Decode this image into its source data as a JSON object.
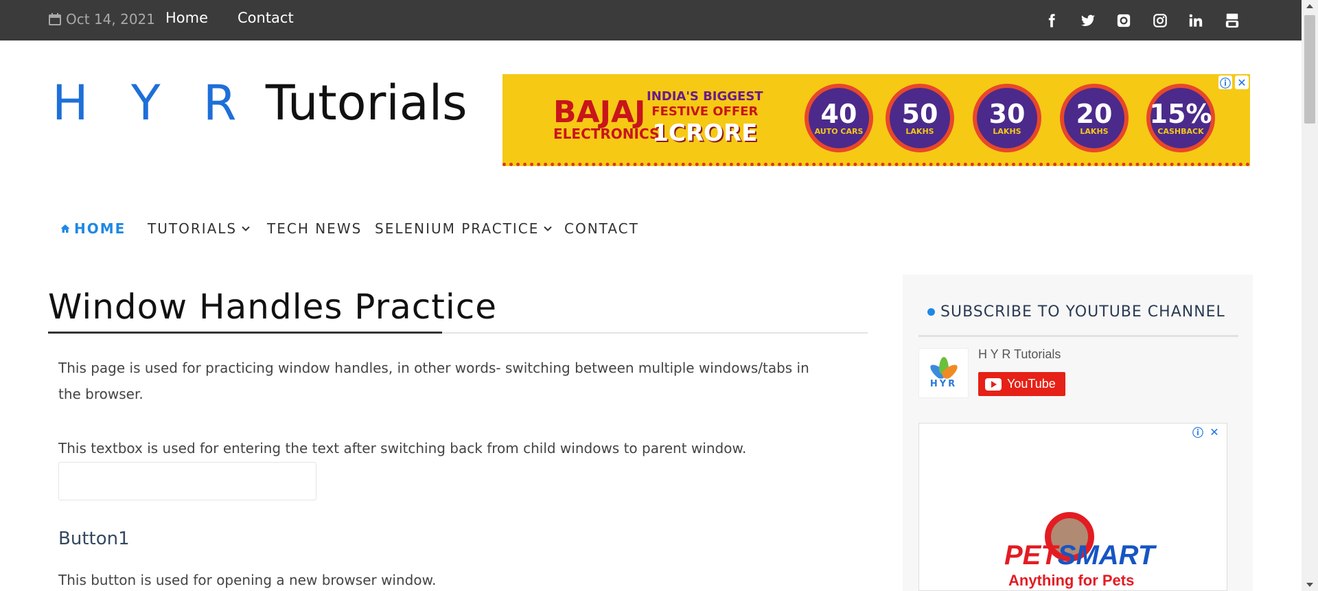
{
  "topbar": {
    "date": "Oct 14, 2021",
    "links": [
      "Home",
      "Contact"
    ],
    "social_icons": [
      "facebook-icon",
      "twitter-icon",
      "github-icon",
      "instagram-icon",
      "linkedin-icon",
      "youtube-icon"
    ]
  },
  "header": {
    "logo_hyr": "H Y R",
    "logo_tutorials": "Tutorials"
  },
  "ad_banner": {
    "brand": "BAJAJ",
    "brand_sub": "ELECTRONICS",
    "offer_line1": "INDIA'S BIGGEST",
    "offer_line2": "FESTIVE OFFER",
    "offer_amount": "1CRORE",
    "badges": [
      {
        "num": "40",
        "unit": "AUTO CARS"
      },
      {
        "num": "50",
        "unit": "LAKHS"
      },
      {
        "num": "30",
        "unit": "LAKHS"
      },
      {
        "num": "20",
        "unit": "LAKHS"
      },
      {
        "num": "15%",
        "unit": "CASHBACK"
      }
    ]
  },
  "nav": {
    "items": [
      {
        "label": "HOME",
        "active": true,
        "dropdown": false
      },
      {
        "label": "TUTORIALS",
        "active": false,
        "dropdown": true
      },
      {
        "label": "TECH NEWS",
        "active": false,
        "dropdown": false
      },
      {
        "label": "SELENIUM PRACTICE",
        "active": false,
        "dropdown": true
      },
      {
        "label": "CONTACT",
        "active": false,
        "dropdown": false
      }
    ]
  },
  "main": {
    "title": "Window Handles Practice",
    "intro": "This page is used for practicing window handles, in other words- switching between multiple windows/tabs in the browser.",
    "textbox_desc": "This textbox is used for entering the text after switching back from child windows to parent window.",
    "textbox_value": "",
    "button1_heading": "Button1",
    "button1_desc": "This button is used for opening a new browser window."
  },
  "sidebar": {
    "widget_title": "SUBSCRIBE TO YOUTUBE CHANNEL",
    "avatar_text": "HYR",
    "channel_name": "H Y R Tutorials",
    "youtube_button": "YouTube",
    "ad": {
      "brand_pet": "PET",
      "brand_smart": "SMART",
      "tagline": "Anything for Pets"
    }
  },
  "colors": {
    "accent": "#1e88e5",
    "topbar": "#3b3b3b",
    "youtube_red": "#e62117"
  }
}
